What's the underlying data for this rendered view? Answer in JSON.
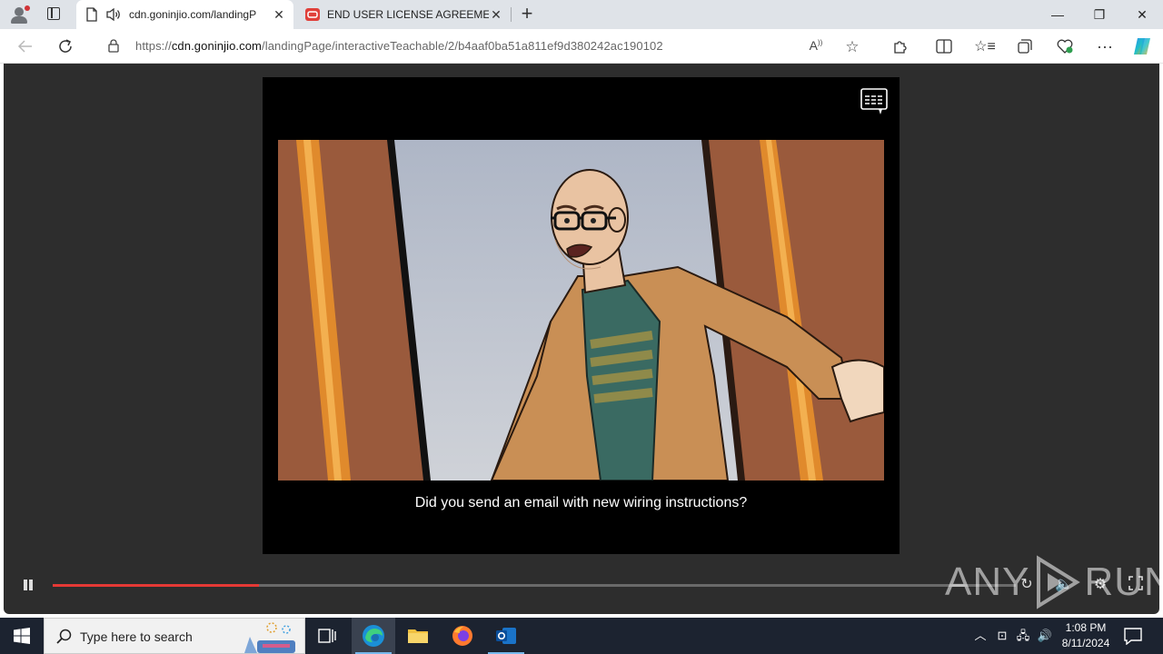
{
  "browser": {
    "tabs": [
      {
        "title": "cdn.goninjio.com/landingP",
        "active": true
      },
      {
        "title": "END USER LICENSE AGREEMENT",
        "active": false
      }
    ],
    "url_scheme": "https://",
    "url_host": "cdn.goninjio.com",
    "url_path": "/landingPage/interactiveTeachable/2/b4aaf0ba51a811ef9d380242ac190102",
    "read_aloud_label": "A"
  },
  "player": {
    "subtitle": "Did you send an email with new wiring instructions?",
    "progress_fraction": 0.214,
    "state": "playing"
  },
  "watermark": {
    "left": "ANY",
    "right": "RUN"
  },
  "taskbar": {
    "search_placeholder": "Type here to search",
    "time": "1:08 PM",
    "date": "8/11/2024"
  },
  "colors": {
    "progress": "#e53935",
    "player_bg": "#2d2d2d",
    "accent": "#0078d4"
  }
}
